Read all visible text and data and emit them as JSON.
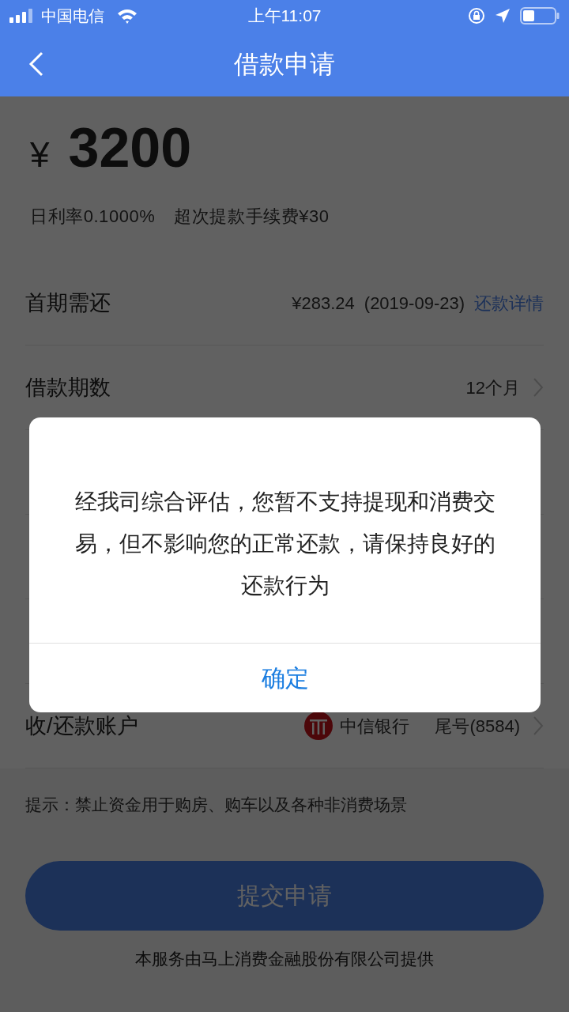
{
  "status_bar": {
    "carrier": "中国电信",
    "time": "上午11:07"
  },
  "header": {
    "title": "借款申请"
  },
  "loan": {
    "currency": "¥",
    "amount": "3200",
    "rate": "日利率0.1000%",
    "fee": "超次提款手续费¥30"
  },
  "rows": [
    {
      "kind": "repayment",
      "label": "首期需还",
      "value": "¥283.24",
      "date": "(2019-09-23)",
      "link": "还款详情"
    },
    {
      "kind": "select",
      "label": "借款期数",
      "value": "12个月"
    },
    {
      "kind": "covered"
    },
    {
      "kind": "covered"
    },
    {
      "kind": "covered"
    },
    {
      "kind": "account",
      "label": "收/还款账户",
      "bank": "中信银行",
      "tail": "尾号(8584)"
    }
  ],
  "hint": "提示：禁止资金用于购房、购车以及各种非消费场景",
  "submit_button": "提交申请",
  "footer": "本服务由马上消费金融股份有限公司提供",
  "dialog": {
    "message": "经我司综合评估，您暂不支持提现和消费交易，但不影响您的正常还款，请保持良好的还款行为",
    "confirm": "确定"
  }
}
